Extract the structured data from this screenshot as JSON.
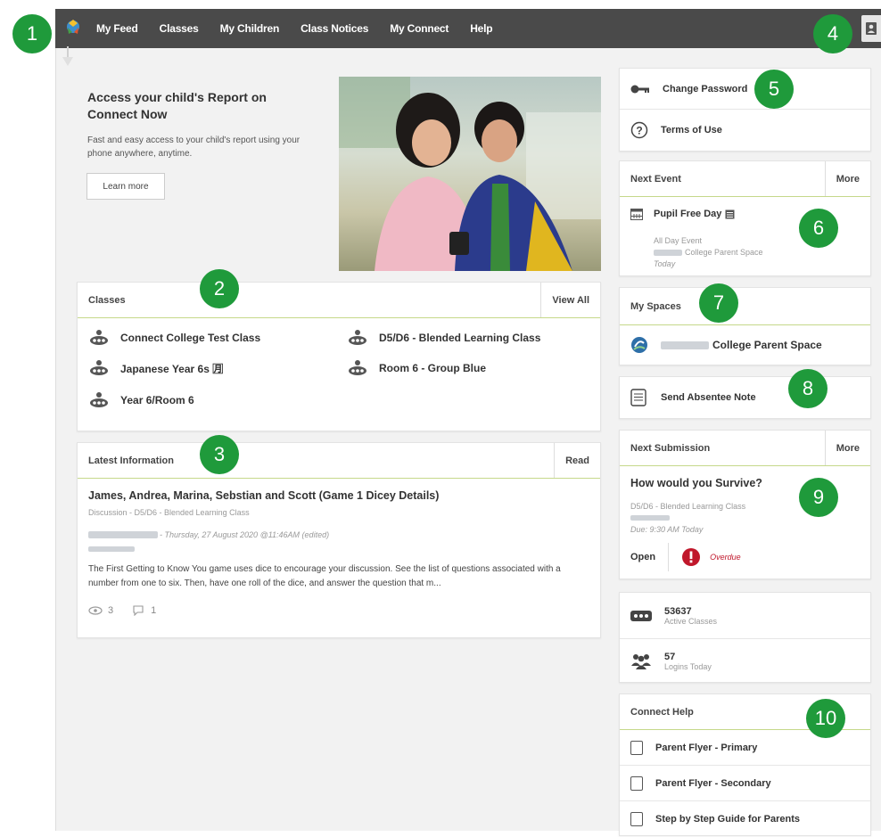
{
  "nav": {
    "items": [
      "My Feed",
      "Classes",
      "My Children",
      "Class Notices",
      "My Connect",
      "Help"
    ]
  },
  "promo": {
    "title": "Access your child's Report on Connect Now",
    "text": "Fast and easy access to your child's report using your phone anywhere, anytime.",
    "button": "Learn more"
  },
  "classes": {
    "title": "Classes",
    "action": "View All",
    "items": [
      "Connect College Test Class",
      "D5/D6 - Blended Learning Class",
      "Japanese Year 6s 🈷",
      "Room 6 - Group Blue",
      "Year 6/Room 6"
    ]
  },
  "latest": {
    "title": "Latest Information",
    "action": "Read",
    "post_title": "James, Andrea, Marina, Sebstian and Scott (Game 1 Dicey Details)",
    "post_meta": "Discussion - D5/D6 - Blended Learning Class",
    "post_date": "- Thursday, 27 August 2020 @11:46AM (edited)",
    "post_body": "The First Getting to Know You game uses dice to encourage your discussion. See the list of questions associated with a number from one to six. Then, have one roll of the dice, and answer the question that m...",
    "views": "3",
    "comments": "1"
  },
  "account": {
    "change_password": "Change Password",
    "terms": "Terms of Use"
  },
  "next_event": {
    "title": "Next Event",
    "action": "More",
    "name": "Pupil Free Day",
    "type": "All Day Event",
    "space": "College Parent Space",
    "when": "Today"
  },
  "my_spaces": {
    "title": "My Spaces",
    "item": "College Parent Space"
  },
  "absentee": {
    "label": "Send Absentee Note"
  },
  "next_submission": {
    "title": "Next Submission",
    "action": "More",
    "name": "How would you Survive?",
    "class": "D5/D6 - Blended Learning Class",
    "due": "Due: 9:30 AM Today",
    "status": "Open",
    "overdue": "Overdue"
  },
  "stats": {
    "active_classes_value": "53637",
    "active_classes_label": "Active Classes",
    "logins_value": "57",
    "logins_label": "Logins Today"
  },
  "help": {
    "title": "Connect Help",
    "items": [
      "Parent Flyer - Primary",
      "Parent Flyer - Secondary",
      "Step by Step Guide for Parents"
    ]
  },
  "callouts": [
    "1",
    "2",
    "3",
    "4",
    "5",
    "6",
    "7",
    "8",
    "9",
    "10"
  ],
  "colors": {
    "accent_green": "#1f9a3b",
    "topbar": "#4a4a4a",
    "divider": "#c5d88a",
    "overdue_red": "#c0172b"
  }
}
